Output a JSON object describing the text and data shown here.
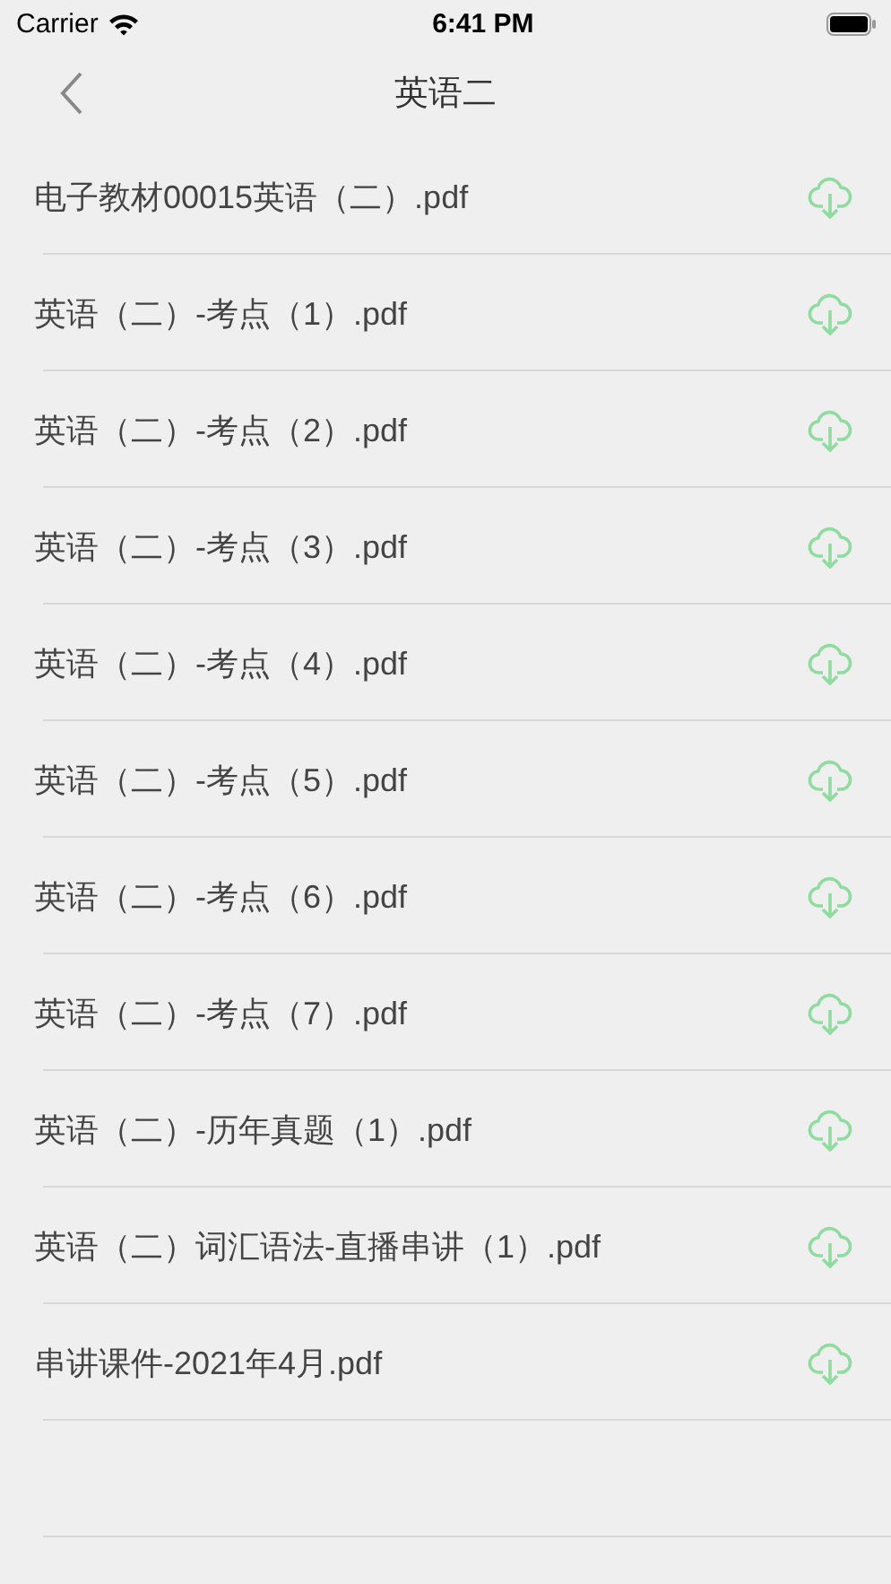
{
  "status_bar": {
    "carrier": "Carrier",
    "time": "6:41 PM"
  },
  "nav": {
    "title": "英语二"
  },
  "files": [
    {
      "name": "电子教材00015英语（二）.pdf"
    },
    {
      "name": "英语（二）-考点（1）.pdf"
    },
    {
      "name": "英语（二）-考点（2）.pdf"
    },
    {
      "name": "英语（二）-考点（3）.pdf"
    },
    {
      "name": "英语（二）-考点（4）.pdf"
    },
    {
      "name": "英语（二）-考点（5）.pdf"
    },
    {
      "name": "英语（二）-考点（6）.pdf"
    },
    {
      "name": "英语（二）-考点（7）.pdf"
    },
    {
      "name": "英语（二）-历年真题（1）.pdf"
    },
    {
      "name": "英语（二）词汇语法-直播串讲（1）.pdf"
    },
    {
      "name": "串讲课件-2021年4月.pdf"
    }
  ]
}
